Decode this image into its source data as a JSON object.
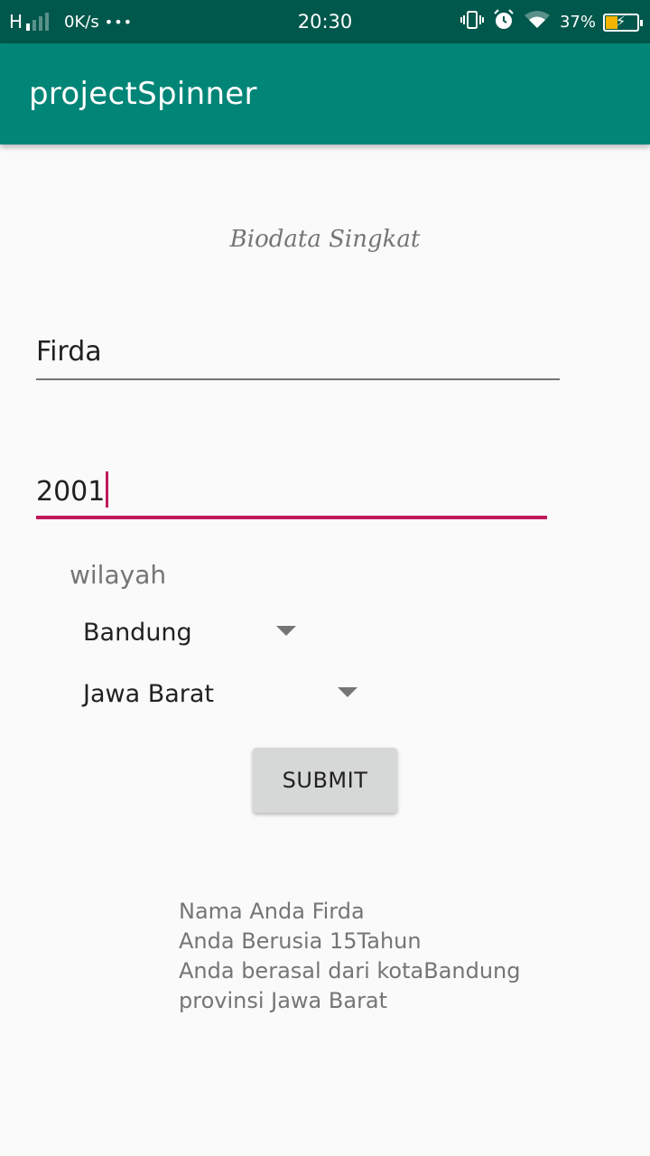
{
  "status_bar": {
    "network_type": "H",
    "speed": "0K/s",
    "more": "•••",
    "time": "20:30",
    "battery_percent": "37%",
    "battery_level": 0.37,
    "icons": [
      "vibrate-icon",
      "alarm-icon",
      "wifi-icon",
      "battery-charging-icon"
    ]
  },
  "app_bar": {
    "title": "projectSpinner"
  },
  "heading": "Biodata Singkat",
  "form": {
    "name_value": "Firda",
    "year_value": "2001",
    "region_label": "wilayah",
    "city_selected": "Bandung",
    "province_selected": "Jawa Barat",
    "submit_label": "SUBMIT"
  },
  "result": {
    "line1": "Nama Anda Firda",
    "line2": "Anda Berusia 15Tahun",
    "line3": "Anda berasal dari kotaBandung",
    "line4": "provinsi Jawa Barat"
  },
  "colors": {
    "status_bar": "#00574b",
    "app_bar": "#008577",
    "accent": "#c2185b",
    "background": "#fafafa"
  }
}
